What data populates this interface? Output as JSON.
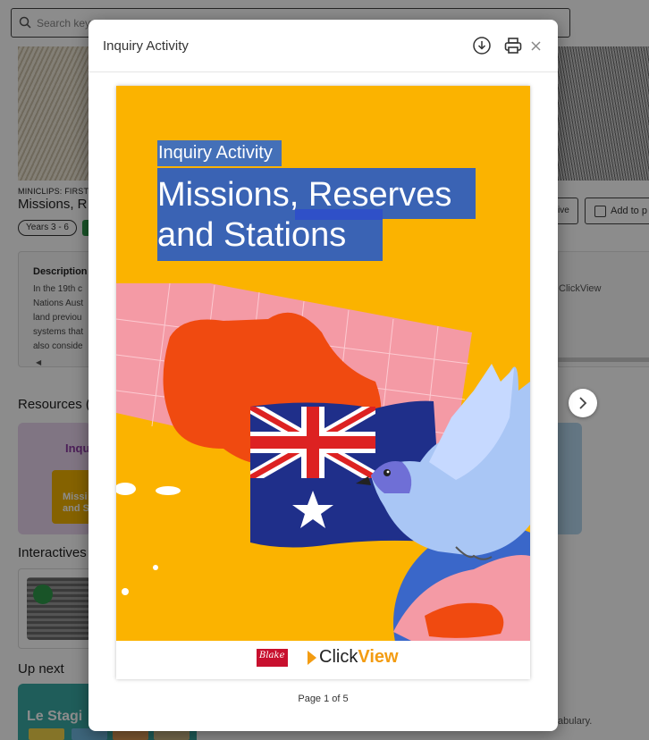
{
  "background": {
    "search": {
      "placeholder": "Search keyw"
    },
    "video": {
      "kicker": "MINICLIPS: FIRST N",
      "title": "Missions, R",
      "year_tag": "Years 3 - 6"
    },
    "description": {
      "heading": "Description",
      "lines": [
        "In the 19th c",
        "Nations Aust",
        "land previou",
        "systems that",
        "also conside"
      ]
    },
    "actions": {
      "save_label": "ive",
      "add_label": "Add to p"
    },
    "right_panel": {
      "text1": "ClickView"
    },
    "sections": {
      "resources": "Resources (",
      "interactives": "Interactives",
      "up_next": "Up next"
    },
    "resource_card": {
      "title": "Inqu",
      "thumb_title": "Missi and S"
    },
    "up_next_card": {
      "title": "Le Stagi"
    },
    "bottom_text": "abulary."
  },
  "modal": {
    "title": "Inquiry Activity",
    "icons": {
      "download": "download-icon",
      "print": "print-icon",
      "close": "close-icon"
    },
    "document": {
      "kicker": "Inquiry Activity",
      "title": "Missions, Reserves and Stations",
      "logos": {
        "publisher": "Blake",
        "brand_prefix": "Click",
        "brand_suffix": "View"
      }
    },
    "page_label": "Page 1 of 5"
  },
  "colors": {
    "doc_orange": "#fbb300",
    "selection_blue": "#3a63b4",
    "brand_orange": "#f39c12"
  }
}
